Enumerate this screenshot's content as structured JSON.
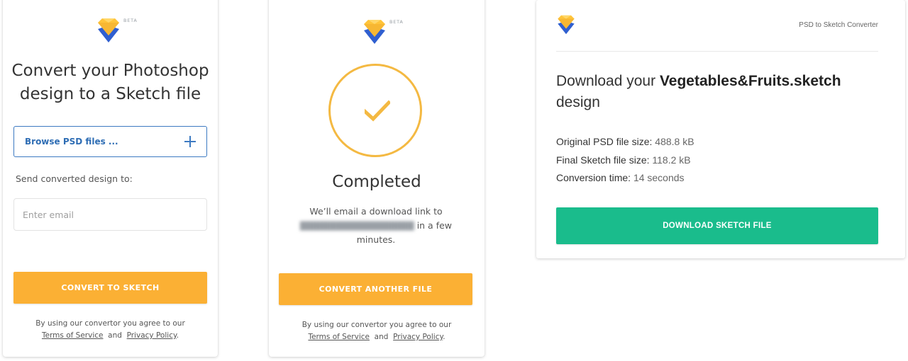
{
  "colors": {
    "accent_orange": "#fbb034",
    "accent_blue": "#3d7ac2",
    "success_green": "#1abc8c",
    "logo_yellow": "#ffc43a",
    "logo_blue": "#2f5fd0"
  },
  "upload_card": {
    "logo_icon": "sketch-diamond-logo",
    "beta_badge": "BETA",
    "headline_line1": "Convert your Photoshop",
    "headline_line2": "design to a Sketch file",
    "browse_label": "Browse PSD files ...",
    "browse_icon": "plus-icon",
    "send_label": "Send converted design to:",
    "email_placeholder": "Enter email",
    "email_value": "",
    "convert_button": "CONVERT TO SKETCH",
    "legal_prefix": "By using our convertor you agree to our",
    "terms_link": "Terms of Service",
    "legal_and": "and",
    "privacy_link": "Privacy Policy",
    "legal_suffix": "."
  },
  "completed_card": {
    "logo_icon": "sketch-diamond-logo",
    "beta_badge": "BETA",
    "status_icon": "checkmark-circle-icon",
    "status_title": "Completed",
    "message_prefix": "We’ll email a download link to",
    "email_redacted": "███████████████████",
    "message_suffix": "in a few minutes.",
    "convert_another_button": "CONVERT ANOTHER FILE",
    "legal_prefix": "By using our convertor you agree to our",
    "terms_link": "Terms of Service",
    "legal_and": "and",
    "privacy_link": "Privacy Policy",
    "legal_suffix": "."
  },
  "download_card": {
    "logo_icon": "sketch-diamond-logo",
    "brand_label": "PSD to Sketch Converter",
    "title_prefix": "Download your",
    "file_name": "Vegetables&Fruits.sketch",
    "title_suffix": "design",
    "stats": [
      {
        "label": "Original PSD file size:",
        "value": "488.8 kB"
      },
      {
        "label": "Final Sketch file size:",
        "value": "118.2 kB"
      },
      {
        "label": "Conversion time:",
        "value": "14 seconds"
      }
    ],
    "download_button": "DOWNLOAD SKETCH FILE"
  }
}
